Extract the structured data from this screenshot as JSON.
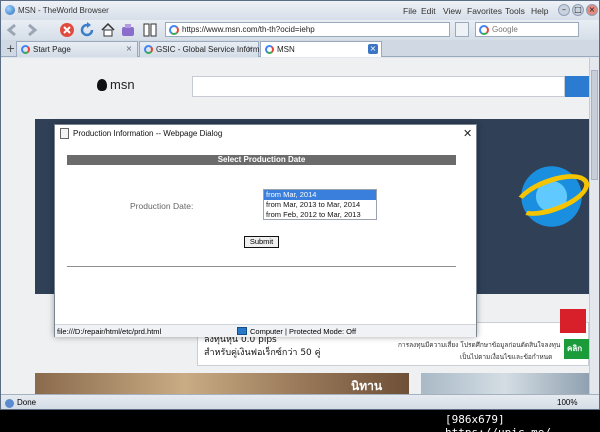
{
  "window": {
    "title": "MSN - TheWorld Browser"
  },
  "menu": [
    "File",
    "Edit",
    "View",
    "Favorites",
    "Tools",
    "Help"
  ],
  "address": {
    "url": "https://www.msn.com/th-th?ocid=iehp"
  },
  "search": {
    "placeholder": "Google"
  },
  "tabs": [
    {
      "label": "Start Page"
    },
    {
      "label": "GSIC - Global Service Inform..."
    },
    {
      "label": "MSN"
    }
  ],
  "page": {
    "logo": "msn",
    "ad": {
      "line1": "ลงทุนหุ้น 0.0 pips",
      "line2": "สำหรับคู่เงินฟอเร็กซ์กว่า 50 คู่",
      "small1": "การลงทุนมีความเสี่ยง โปรดศึกษาข้อมูลก่อนตัดสินใจลงทุน",
      "small2": "เป็นไปตามเงื่อนไขและข้อกำหนด",
      "button": "คลิก"
    },
    "photo_caption": "นิทาน"
  },
  "dialog": {
    "title": "Production Information -- Webpage Dialog",
    "header": "Select Production Date",
    "label": "Production Date:",
    "options": [
      "from Mar, 2014",
      "from Mar, 2013 to Mar, 2014",
      "from Feb, 2012 to Mar, 2013"
    ],
    "selected_index": 0,
    "submit": "Submit",
    "status_path": "file:///D:/repair/html/etc/prd.html",
    "status_zone": "Computer | Protected Mode: Off"
  },
  "statusbar": {
    "text": "Done",
    "zoom": "100%"
  },
  "watermark": "[986x679] https://upic.me/"
}
